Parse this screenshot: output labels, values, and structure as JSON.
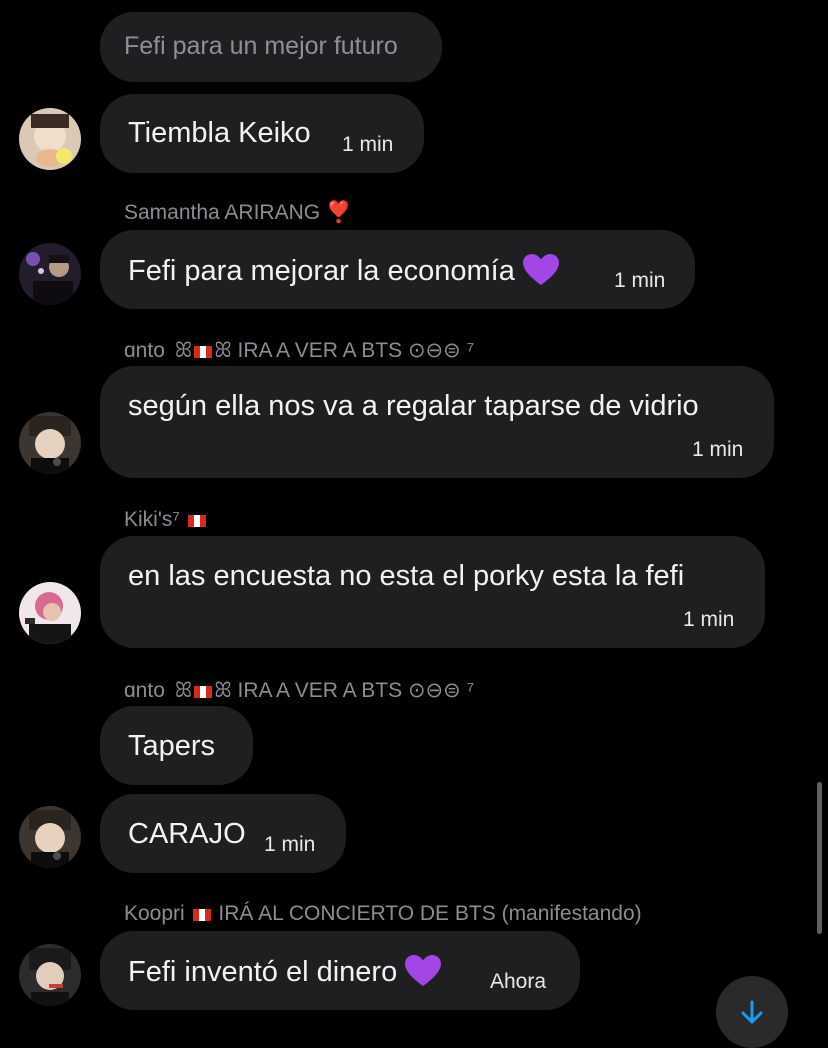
{
  "messages": [
    {
      "text": "Fefi para un mejor futuro"
    },
    {
      "text": "Tiembla Keiko",
      "time": "1 min"
    },
    {
      "sender": "Samantha ARIRANG ❣️",
      "text": "Fefi para mejorar la economía",
      "time": "1 min"
    },
    {
      "sender_name": "ɑnto",
      "sender_tail": "IRA A VER A BTS ⊙⊖⊜ ⁷",
      "text": "según ella nos va a regalar taparse de vidrio",
      "time": "1 min"
    },
    {
      "sender_name": "Kiki's⁷",
      "text": "en las encuesta no esta el porky esta la fefi",
      "time": "1 min"
    },
    {
      "sender_name": "ɑnto",
      "sender_tail": "IRA A VER A BTS ⊙⊖⊜ ⁷",
      "text": "Tapers"
    },
    {
      "text": "CARAJO",
      "time": "1 min"
    },
    {
      "sender_name": "Koopri",
      "sender_tail": "IRÁ AL CONCIERTO DE BTS (manifestando)",
      "text": "Fefi inventó el dinero",
      "time": "Ahora"
    }
  ],
  "icons": {
    "heart": "purple-heart-icon",
    "red_heart": "heavy-heart-exclamation-icon",
    "flag": "peru-flag-icon",
    "scroll": "arrow-down-icon"
  },
  "colors": {
    "background": "#000000",
    "bubble": "#1f1f21",
    "sender": "#8a8d91",
    "accent": "#1d9bf0",
    "heart": "#a246e6"
  }
}
